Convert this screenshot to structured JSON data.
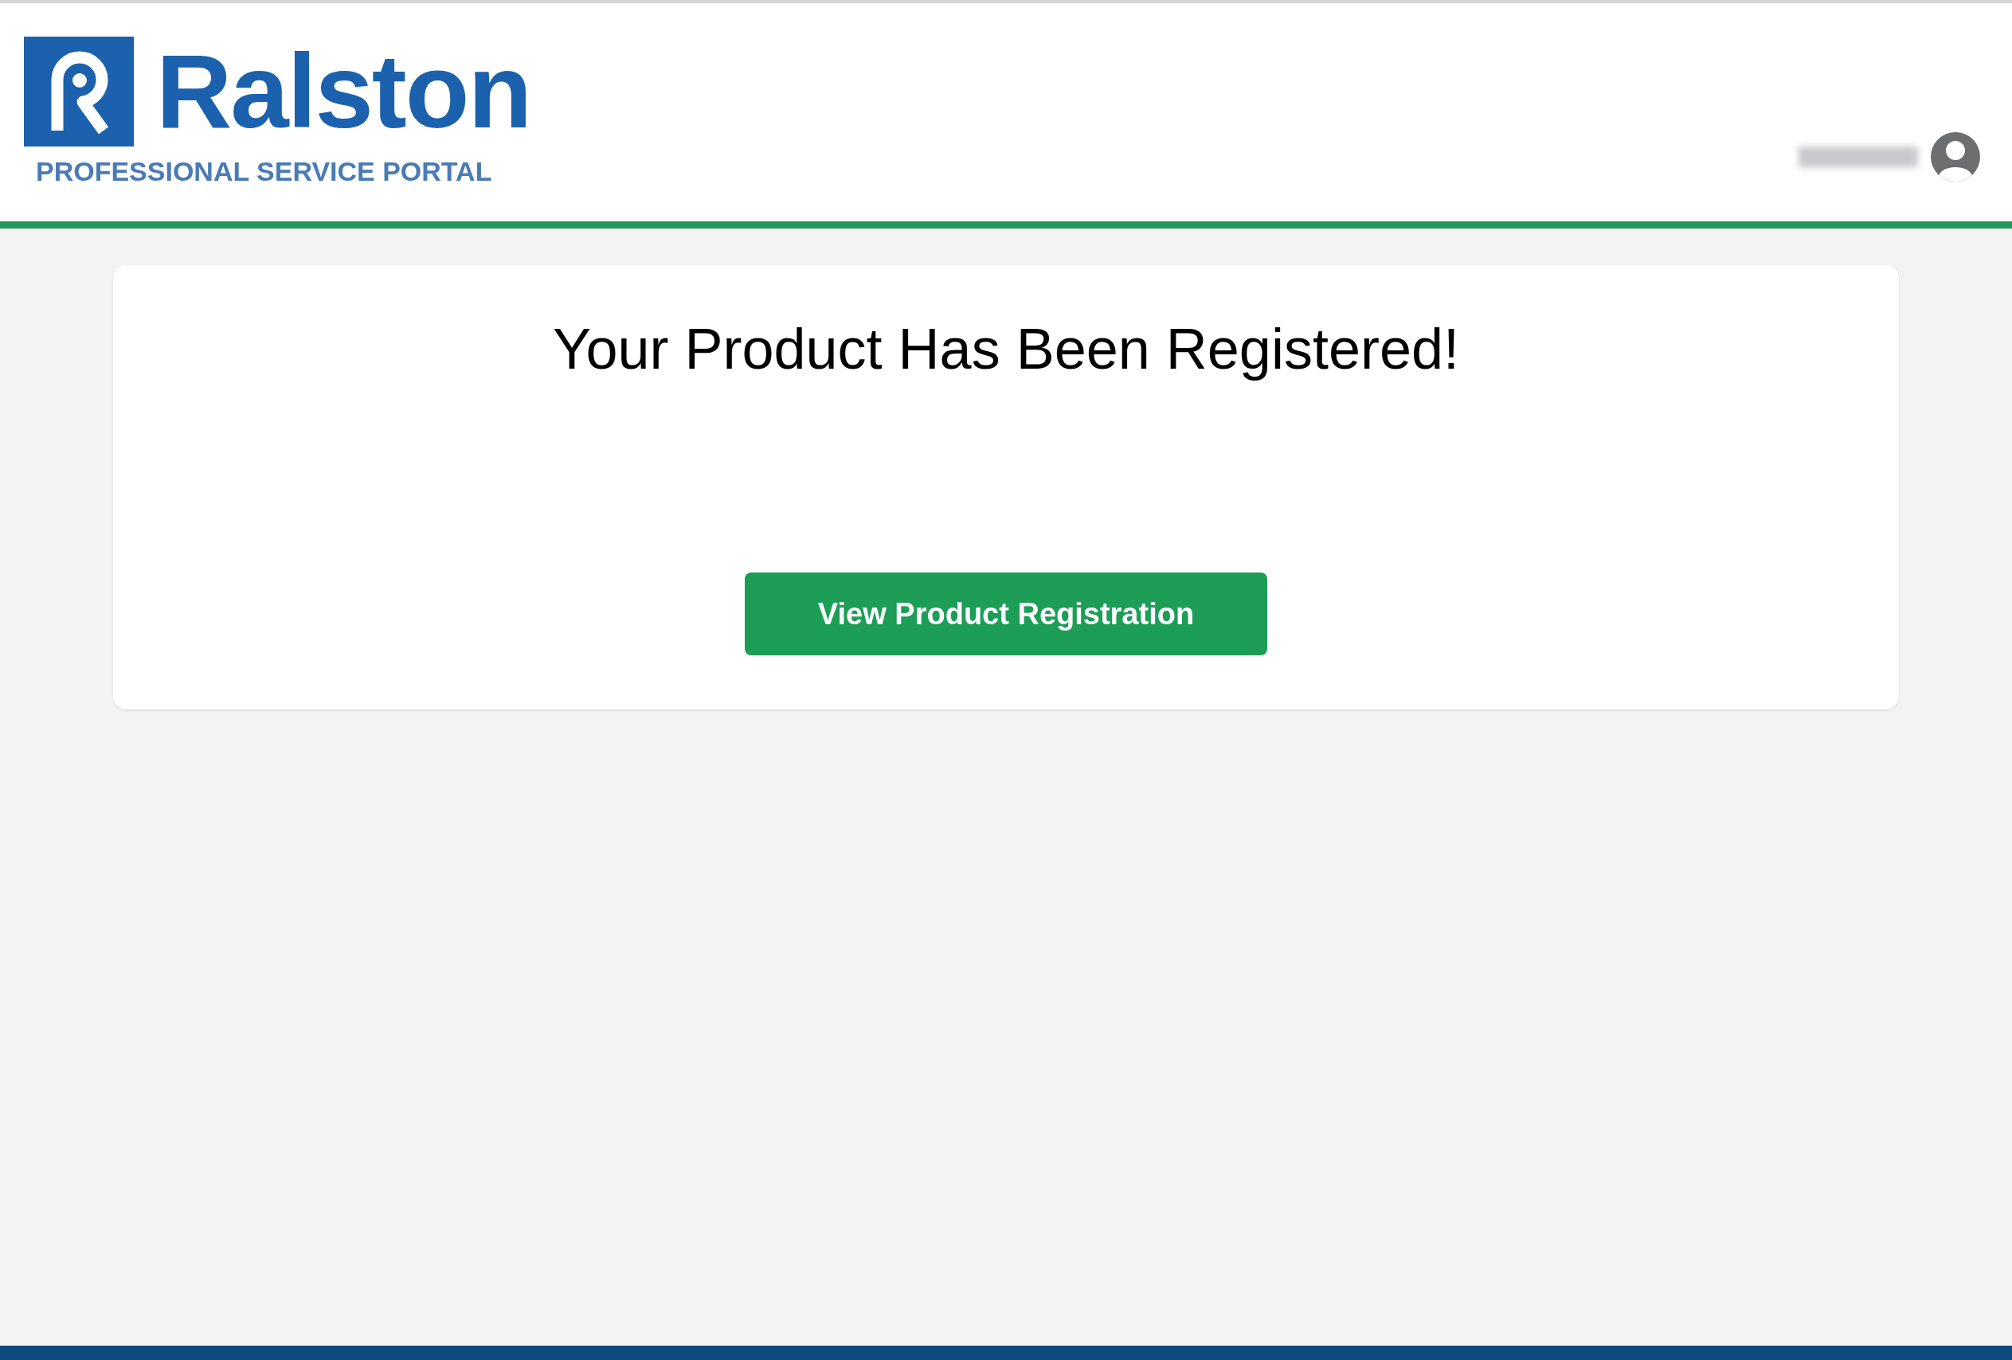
{
  "header": {
    "logo": {
      "wordmark": "Ralston",
      "tagline": "PROFESSIONAL SERVICE PORTAL"
    },
    "user": {
      "name_redacted": true
    }
  },
  "card": {
    "title": "Your Product Has Been Registered!",
    "button": "View Product Registration"
  }
}
